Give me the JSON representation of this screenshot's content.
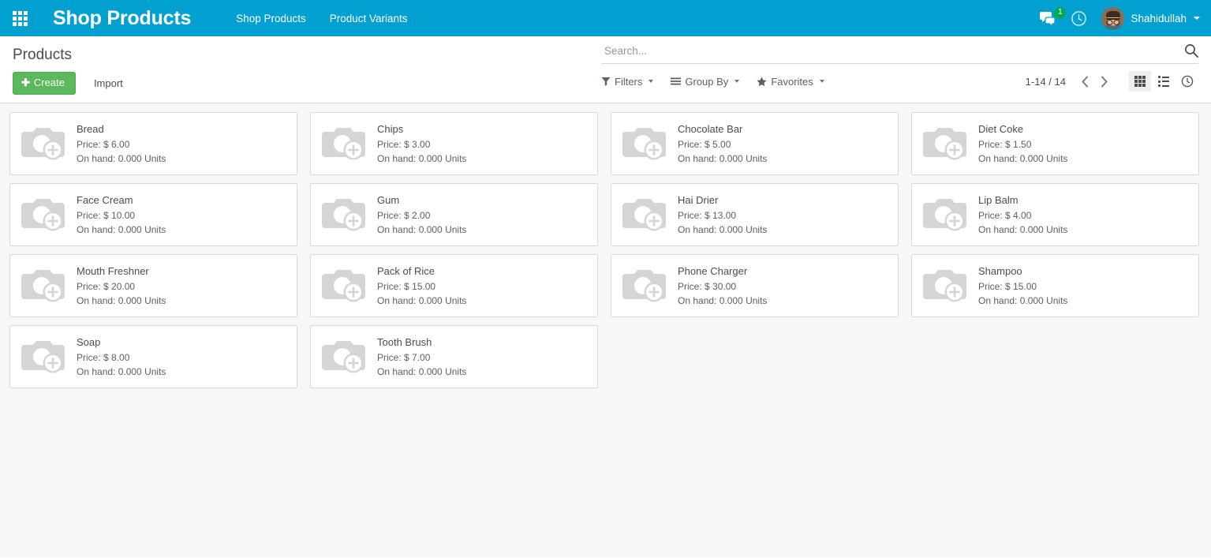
{
  "navbar": {
    "apps_icon": "apps-grid-icon",
    "brand": "Shop Products",
    "menu": [
      {
        "label": "Shop Products"
      },
      {
        "label": "Product Variants"
      }
    ],
    "messages_icon": "chat-bubble-icon",
    "messages_count": "1",
    "activity_icon": "clock-icon",
    "user": "Shahidullah",
    "accent_color": "#00A0D1",
    "badge_color": "#00A94F"
  },
  "control_panel": {
    "title": "Products",
    "create_label": "Create",
    "create_icon": "plus-icon",
    "create_color": "#5cb85c",
    "import_label": "Import",
    "search": {
      "value": "",
      "placeholder": "Search...",
      "icon": "search-icon"
    },
    "dropdowns": [
      {
        "label": "Filters",
        "icon": "filter-funnel-icon"
      },
      {
        "label": "Group By",
        "icon": "group-lines-icon"
      },
      {
        "label": "Favorites",
        "icon": "star-icon"
      }
    ],
    "pager": {
      "range": "1-14 / 14",
      "prev_icon": "chevron-left-icon",
      "next_icon": "chevron-right-icon"
    },
    "views": [
      {
        "name": "kanban",
        "icon": "kanban-grid-icon",
        "active": true
      },
      {
        "name": "list",
        "icon": "list-icon",
        "active": false
      },
      {
        "name": "activity",
        "icon": "clock-icon",
        "active": false
      }
    ]
  },
  "products": [
    {
      "name": "Bread",
      "price": "Price: $ 6.00",
      "on_hand": "On hand: 0.000 Units",
      "image": "image-placeholder-camera-icon"
    },
    {
      "name": "Chips",
      "price": "Price: $ 3.00",
      "on_hand": "On hand: 0.000 Units",
      "image": "image-placeholder-camera-icon"
    },
    {
      "name": "Chocolate Bar",
      "price": "Price: $ 5.00",
      "on_hand": "On hand: 0.000 Units",
      "image": "image-placeholder-camera-icon"
    },
    {
      "name": "Diet Coke",
      "price": "Price: $ 1.50",
      "on_hand": "On hand: 0.000 Units",
      "image": "image-placeholder-camera-icon"
    },
    {
      "name": "Face Cream",
      "price": "Price: $ 10.00",
      "on_hand": "On hand: 0.000 Units",
      "image": "image-placeholder-camera-icon"
    },
    {
      "name": "Gum",
      "price": "Price: $ 2.00",
      "on_hand": "On hand: 0.000 Units",
      "image": "image-placeholder-camera-icon"
    },
    {
      "name": "Hai Drier",
      "price": "Price: $ 13.00",
      "on_hand": "On hand: 0.000 Units",
      "image": "image-placeholder-camera-icon"
    },
    {
      "name": "Lip Balm",
      "price": "Price: $ 4.00",
      "on_hand": "On hand: 0.000 Units",
      "image": "image-placeholder-camera-icon"
    },
    {
      "name": "Mouth Freshner",
      "price": "Price: $ 20.00",
      "on_hand": "On hand: 0.000 Units",
      "image": "image-placeholder-camera-icon"
    },
    {
      "name": "Pack of Rice",
      "price": "Price: $ 15.00",
      "on_hand": "On hand: 0.000 Units",
      "image": "image-placeholder-camera-icon"
    },
    {
      "name": "Phone Charger",
      "price": "Price: $ 30.00",
      "on_hand": "On hand: 0.000 Units",
      "image": "image-placeholder-camera-icon"
    },
    {
      "name": "Shampoo",
      "price": "Price: $ 15.00",
      "on_hand": "On hand: 0.000 Units",
      "image": "image-placeholder-camera-icon"
    },
    {
      "name": "Soap",
      "price": "Price: $ 8.00",
      "on_hand": "On hand: 0.000 Units",
      "image": "image-placeholder-camera-icon"
    },
    {
      "name": "Tooth Brush",
      "price": "Price: $ 7.00",
      "on_hand": "On hand: 0.000 Units",
      "image": "image-placeholder-camera-icon"
    }
  ]
}
